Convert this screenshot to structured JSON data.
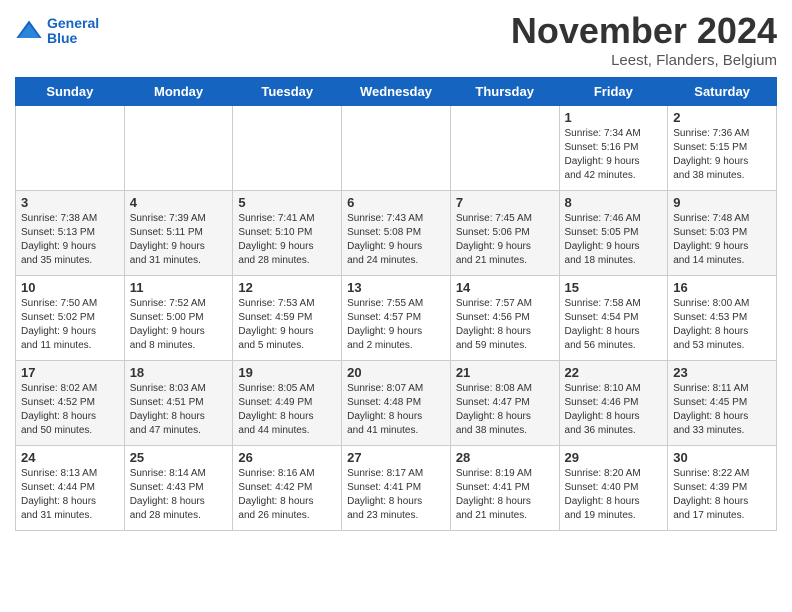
{
  "logo": {
    "line1": "General",
    "line2": "Blue"
  },
  "title": "November 2024",
  "subtitle": "Leest, Flanders, Belgium",
  "days_of_week": [
    "Sunday",
    "Monday",
    "Tuesday",
    "Wednesday",
    "Thursday",
    "Friday",
    "Saturday"
  ],
  "weeks": [
    [
      {
        "day": "",
        "info": ""
      },
      {
        "day": "",
        "info": ""
      },
      {
        "day": "",
        "info": ""
      },
      {
        "day": "",
        "info": ""
      },
      {
        "day": "",
        "info": ""
      },
      {
        "day": "1",
        "info": "Sunrise: 7:34 AM\nSunset: 5:16 PM\nDaylight: 9 hours\nand 42 minutes."
      },
      {
        "day": "2",
        "info": "Sunrise: 7:36 AM\nSunset: 5:15 PM\nDaylight: 9 hours\nand 38 minutes."
      }
    ],
    [
      {
        "day": "3",
        "info": "Sunrise: 7:38 AM\nSunset: 5:13 PM\nDaylight: 9 hours\nand 35 minutes."
      },
      {
        "day": "4",
        "info": "Sunrise: 7:39 AM\nSunset: 5:11 PM\nDaylight: 9 hours\nand 31 minutes."
      },
      {
        "day": "5",
        "info": "Sunrise: 7:41 AM\nSunset: 5:10 PM\nDaylight: 9 hours\nand 28 minutes."
      },
      {
        "day": "6",
        "info": "Sunrise: 7:43 AM\nSunset: 5:08 PM\nDaylight: 9 hours\nand 24 minutes."
      },
      {
        "day": "7",
        "info": "Sunrise: 7:45 AM\nSunset: 5:06 PM\nDaylight: 9 hours\nand 21 minutes."
      },
      {
        "day": "8",
        "info": "Sunrise: 7:46 AM\nSunset: 5:05 PM\nDaylight: 9 hours\nand 18 minutes."
      },
      {
        "day": "9",
        "info": "Sunrise: 7:48 AM\nSunset: 5:03 PM\nDaylight: 9 hours\nand 14 minutes."
      }
    ],
    [
      {
        "day": "10",
        "info": "Sunrise: 7:50 AM\nSunset: 5:02 PM\nDaylight: 9 hours\nand 11 minutes."
      },
      {
        "day": "11",
        "info": "Sunrise: 7:52 AM\nSunset: 5:00 PM\nDaylight: 9 hours\nand 8 minutes."
      },
      {
        "day": "12",
        "info": "Sunrise: 7:53 AM\nSunset: 4:59 PM\nDaylight: 9 hours\nand 5 minutes."
      },
      {
        "day": "13",
        "info": "Sunrise: 7:55 AM\nSunset: 4:57 PM\nDaylight: 9 hours\nand 2 minutes."
      },
      {
        "day": "14",
        "info": "Sunrise: 7:57 AM\nSunset: 4:56 PM\nDaylight: 8 hours\nand 59 minutes."
      },
      {
        "day": "15",
        "info": "Sunrise: 7:58 AM\nSunset: 4:54 PM\nDaylight: 8 hours\nand 56 minutes."
      },
      {
        "day": "16",
        "info": "Sunrise: 8:00 AM\nSunset: 4:53 PM\nDaylight: 8 hours\nand 53 minutes."
      }
    ],
    [
      {
        "day": "17",
        "info": "Sunrise: 8:02 AM\nSunset: 4:52 PM\nDaylight: 8 hours\nand 50 minutes."
      },
      {
        "day": "18",
        "info": "Sunrise: 8:03 AM\nSunset: 4:51 PM\nDaylight: 8 hours\nand 47 minutes."
      },
      {
        "day": "19",
        "info": "Sunrise: 8:05 AM\nSunset: 4:49 PM\nDaylight: 8 hours\nand 44 minutes."
      },
      {
        "day": "20",
        "info": "Sunrise: 8:07 AM\nSunset: 4:48 PM\nDaylight: 8 hours\nand 41 minutes."
      },
      {
        "day": "21",
        "info": "Sunrise: 8:08 AM\nSunset: 4:47 PM\nDaylight: 8 hours\nand 38 minutes."
      },
      {
        "day": "22",
        "info": "Sunrise: 8:10 AM\nSunset: 4:46 PM\nDaylight: 8 hours\nand 36 minutes."
      },
      {
        "day": "23",
        "info": "Sunrise: 8:11 AM\nSunset: 4:45 PM\nDaylight: 8 hours\nand 33 minutes."
      }
    ],
    [
      {
        "day": "24",
        "info": "Sunrise: 8:13 AM\nSunset: 4:44 PM\nDaylight: 8 hours\nand 31 minutes."
      },
      {
        "day": "25",
        "info": "Sunrise: 8:14 AM\nSunset: 4:43 PM\nDaylight: 8 hours\nand 28 minutes."
      },
      {
        "day": "26",
        "info": "Sunrise: 8:16 AM\nSunset: 4:42 PM\nDaylight: 8 hours\nand 26 minutes."
      },
      {
        "day": "27",
        "info": "Sunrise: 8:17 AM\nSunset: 4:41 PM\nDaylight: 8 hours\nand 23 minutes."
      },
      {
        "day": "28",
        "info": "Sunrise: 8:19 AM\nSunset: 4:41 PM\nDaylight: 8 hours\nand 21 minutes."
      },
      {
        "day": "29",
        "info": "Sunrise: 8:20 AM\nSunset: 4:40 PM\nDaylight: 8 hours\nand 19 minutes."
      },
      {
        "day": "30",
        "info": "Sunrise: 8:22 AM\nSunset: 4:39 PM\nDaylight: 8 hours\nand 17 minutes."
      }
    ]
  ]
}
